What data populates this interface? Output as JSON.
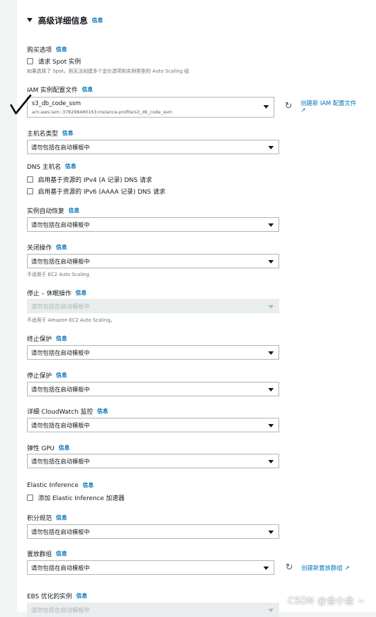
{
  "section": {
    "title": "高级详细信息",
    "info": "信息"
  },
  "purchase": {
    "label": "购买选项",
    "info": "信息",
    "checkbox_label": "请求 Spot 实例",
    "help": "如果选择了 Spot，则无法创建多个定价选项和实例类型的 Auto Scaling 组"
  },
  "iam": {
    "label": "IAM 实例配置文件",
    "info": "信息",
    "name": "s3_db_code_ssm",
    "arn": "arn:aws:iam::378298480163:instance-profile/s3_db_code_ssm",
    "create_link": "创建新 IAM 配置文件"
  },
  "hostname_type": {
    "label": "主机名类型",
    "info": "信息",
    "value": "请勿包括在启动模板中"
  },
  "dns": {
    "label": "DNS 主机名",
    "info": "信息",
    "ipv4": "启用基于资源的 IPv4 (A 记录) DNS 请求",
    "ipv6": "启用基于资源的 IPv6 (AAAA 记录) DNS 请求"
  },
  "auto_recovery": {
    "label": "实例自动恢复",
    "info": "信息",
    "value": "请勿包括在启动模板中"
  },
  "shutdown": {
    "label": "关闭操作",
    "info": "信息",
    "value": "请勿包括在启动模板中",
    "help": "不适用于 EC2 Auto Scaling"
  },
  "stop_hibernate": {
    "label": "停止 – 休眠操作",
    "info": "信息",
    "value": "请勿包括在启动模板中",
    "help": "不适用于 Amazon EC2 Auto Scaling。"
  },
  "termination": {
    "label": "终止保护",
    "info": "信息",
    "value": "请勿包括在启动模板中"
  },
  "stop_protection": {
    "label": "停止保护",
    "info": "信息",
    "value": "请勿包括在启动模板中"
  },
  "cloudwatch": {
    "label": "详细 CloudWatch 监控",
    "info": "信息",
    "value": "请勿包括在启动模板中"
  },
  "elastic_gpu": {
    "label": "弹性 GPU",
    "info": "信息",
    "value": "请勿包括在启动模板中"
  },
  "elastic_inference": {
    "label": "Elastic Inference",
    "info": "信息",
    "checkbox_label": "添加 Elastic Inference 加速器"
  },
  "credit": {
    "label": "积分规范",
    "info": "信息",
    "value": "请勿包括在启动模板中"
  },
  "placement": {
    "label": "置放群组",
    "info": "信息",
    "value": "请勿包括在启动模板中",
    "create_link": "创建新置放群组"
  },
  "ebs": {
    "label": "EBS 优化的实例",
    "info": "信息",
    "value": "请勿包括在启动模板中"
  },
  "watermark": "CSDN @金小金 ~"
}
